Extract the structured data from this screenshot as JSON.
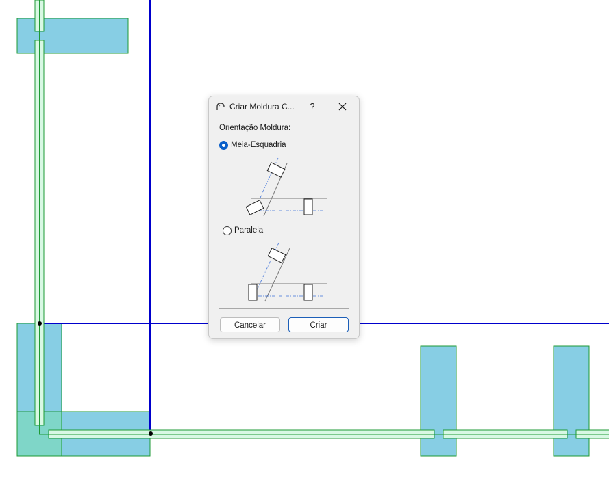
{
  "dialog": {
    "title": "Criar Moldura C...",
    "help_label": "?",
    "group_label": "Orientação Moldura:",
    "options": [
      {
        "label": "Meia-Esquadria",
        "selected": true
      },
      {
        "label": "Paralela",
        "selected": false
      }
    ],
    "cancel_label": "Cancelar",
    "create_label": "Criar"
  },
  "colors": {
    "axis_blue": "#0000cc",
    "fill_blue": "#87cee4",
    "frame_green": "#1e9a34",
    "frame_fill": "#d8f8e4",
    "accent": "#0a5fc9"
  }
}
